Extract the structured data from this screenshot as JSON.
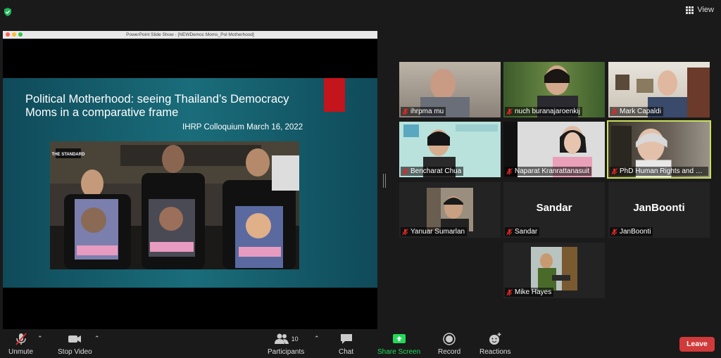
{
  "view_label": "View",
  "share": {
    "window_title": "PowerPoint Slide Show - [NEWDemoc Moms_Pol Motherhood]",
    "slide_title": "Political Motherhood: seeing Thailand’s Democracy Moms in a comparative frame",
    "slide_subtitle": "IHRP Colloquium March 16, 2022",
    "photo_brand": "THE STANDARD"
  },
  "participants": [
    {
      "name": "ihrpma mu",
      "muted": true
    },
    {
      "name": "nuch buranajaroenkij",
      "muted": true
    },
    {
      "name": "Mark Capaldi",
      "muted": true
    },
    {
      "name": "Bencharat Chua",
      "muted": true
    },
    {
      "name": "Naparat Kranrattanasuit",
      "muted": true
    },
    {
      "name": "PhD Human Rights and Peac...",
      "muted": true,
      "active_speaker": true
    },
    {
      "name": "Yanuar Sumarlan",
      "muted": true
    },
    {
      "name": "Sandar",
      "display": "Sandar",
      "muted": true
    },
    {
      "name": "JanBoonti",
      "display": "JanBoonti",
      "muted": true
    },
    {
      "name": "Mike Hayes",
      "muted": true
    }
  ],
  "toolbar": {
    "unmute": "Unmute",
    "stop_video": "Stop Video",
    "participants": "Participants",
    "participants_count": "10",
    "chat": "Chat",
    "share_screen": "Share Screen",
    "record": "Record",
    "reactions": "Reactions",
    "leave": "Leave"
  },
  "colors": {
    "share_green": "#23d959",
    "leave_red": "#d13a3a",
    "active_border": "#c9e05a",
    "mute_red": "#e02828"
  }
}
